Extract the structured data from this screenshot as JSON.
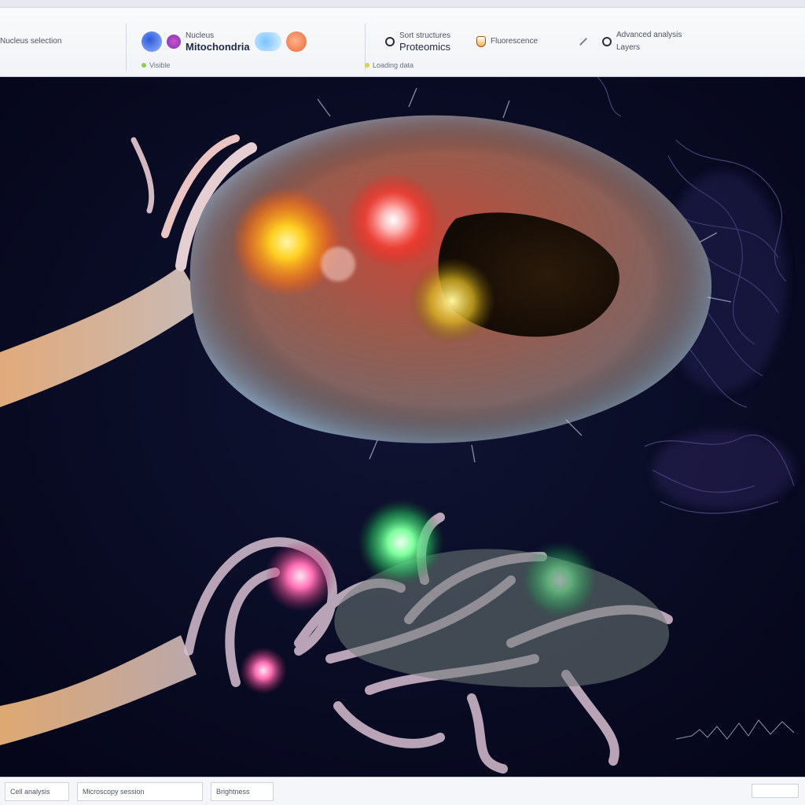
{
  "toolbar": {
    "group1": {
      "label": "Nucleus selection"
    },
    "group2": {
      "title": "Mitochondria",
      "subtitle": "Nucleus",
      "status": "Visible"
    },
    "group3": {
      "label": "Sort structures",
      "title": "Proteomics",
      "status": "Loading data"
    },
    "group4": {
      "label": "Fluorescence"
    },
    "group5": {
      "label": "Advanced analysis",
      "subtitle": "Layers"
    }
  },
  "statusbar": {
    "items": [
      "Cell analysis",
      "Microscopy session",
      "Brightness"
    ]
  },
  "colors": {
    "background": "#06071a",
    "membrane": "#b7a596",
    "glow_orange": "#ffb020",
    "glow_red": "#ff4a3d",
    "glow_green": "#5cff8a",
    "glow_pink": "#ff5ca8"
  }
}
